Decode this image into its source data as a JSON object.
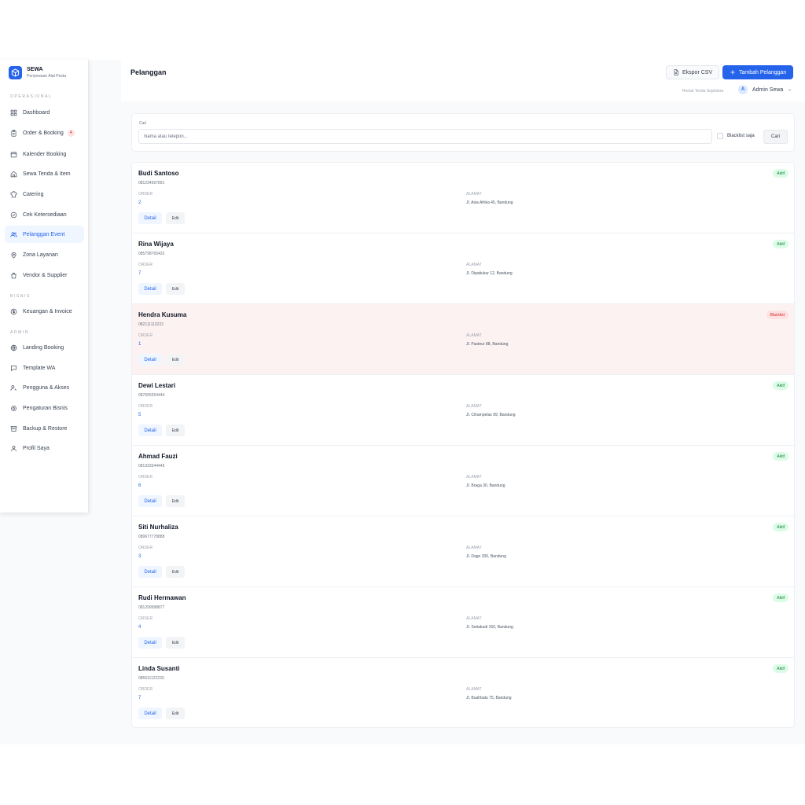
{
  "brand": {
    "name": "SEWA",
    "subtitle": "Penyewaan Alat Pesta"
  },
  "sidebar": {
    "sections": [
      {
        "label": "OPERASIONAL"
      },
      {
        "label": "BISNIS"
      },
      {
        "label": "ADMIN"
      }
    ],
    "items": [
      {
        "label": "Dashboard",
        "icon": "grid-icon"
      },
      {
        "label": "Order & Booking",
        "icon": "clipboard-icon",
        "badge": "4"
      },
      {
        "label": "Kalender Booking",
        "icon": "calendar-icon"
      },
      {
        "label": "Sewa Tenda & Item",
        "icon": "home-icon"
      },
      {
        "label": "Catering",
        "icon": "chef-icon"
      },
      {
        "label": "Cek Ketersediaan",
        "icon": "check-circle-icon"
      },
      {
        "label": "Pelanggan Event",
        "icon": "users-icon",
        "active": true
      },
      {
        "label": "Zona Layanan",
        "icon": "map-pin-icon"
      },
      {
        "label": "Vendor & Supplier",
        "icon": "shopping-bag-icon"
      },
      {
        "label": "Keuangan & Invoice",
        "icon": "dollar-circle-icon"
      },
      {
        "label": "Landing Booking",
        "icon": "globe-icon"
      },
      {
        "label": "Template WA",
        "icon": "message-icon"
      },
      {
        "label": "Pengguna & Akses",
        "icon": "user-key-icon"
      },
      {
        "label": "Pengaturan Bisnis",
        "icon": "settings-circle-icon"
      },
      {
        "label": "Backup & Restore",
        "icon": "archive-icon"
      },
      {
        "label": "Profil Saya",
        "icon": "user-icon"
      }
    ]
  },
  "header": {
    "title": "Pelanggan",
    "export_label": "Ekspor CSV",
    "add_label": "Tambah Pelanggan",
    "org_name": "Rental Tenda Sejahtera",
    "avatar_initial": "A",
    "user_name": "Admin Sewa"
  },
  "search": {
    "label": "Cari",
    "placeholder": "Nama atau telepon...",
    "blacklist_label": "Blacklist saja",
    "button_label": "Cari"
  },
  "colors": {
    "accent": "#2563eb",
    "active_badge": "#dcfce7",
    "blacklist_badge": "#fee2e2",
    "blacklist_row": "#fdf2f2"
  },
  "customers": [
    {
      "name": "Budi Santoso",
      "phone": "081234567891",
      "order_label": "ORDER",
      "orders": "2",
      "address_label": "ALAMAT",
      "address": "Jl. Asia Afrika 45, Bandung",
      "status": "Aktif",
      "detail_label": "Detail",
      "edit_label": "Edit"
    },
    {
      "name": "Rina Wijaya",
      "phone": "085798765432",
      "order_label": "ORDER",
      "orders": "7",
      "address_label": "ALAMAT",
      "address": "Jl. Dipatiukur 12, Bandung",
      "status": "Aktif",
      "detail_label": "Detail",
      "edit_label": "Edit"
    },
    {
      "name": "Hendra Kusuma",
      "phone": "082111113222",
      "order_label": "ORDER",
      "orders": "1",
      "address_label": "ALAMAT",
      "address": "Jl. Pasteur 88, Bandung",
      "status": "Blacklist",
      "detail_label": "Detail",
      "edit_label": "Edit"
    },
    {
      "name": "Dewi Lestari",
      "phone": "087655554444",
      "order_label": "ORDER",
      "orders": "5",
      "address_label": "ALAMAT",
      "address": "Jl. Cihampelas 99, Bandung",
      "status": "Aktif",
      "detail_label": "Detail",
      "edit_label": "Edit"
    },
    {
      "name": "Ahmad Fauzi",
      "phone": "081333344445",
      "order_label": "ORDER",
      "orders": "6",
      "address_label": "ALAMAT",
      "address": "Jl. Braga 30, Bandung",
      "status": "Aktif",
      "detail_label": "Detail",
      "edit_label": "Edit"
    },
    {
      "name": "Siti Nurhaliza",
      "phone": "089677778888",
      "order_label": "ORDER",
      "orders": "3",
      "address_label": "ALAMAT",
      "address": "Jl. Dago 200, Bandung",
      "status": "Aktif",
      "detail_label": "Detail",
      "edit_label": "Edit"
    },
    {
      "name": "Rudi Hermawan",
      "phone": "081299998877",
      "order_label": "ORDER",
      "orders": "4",
      "address_label": "ALAMAT",
      "address": "Jl. Setiabudi 150, Bandung",
      "status": "Aktif",
      "detail_label": "Detail",
      "edit_label": "Edit"
    },
    {
      "name": "Linda Susanti",
      "phone": "085611122233",
      "order_label": "ORDER",
      "orders": "7",
      "address_label": "ALAMAT",
      "address": "Jl. Buahbatu 75, Bandung",
      "status": "Aktif",
      "detail_label": "Detail",
      "edit_label": "Edit"
    }
  ]
}
